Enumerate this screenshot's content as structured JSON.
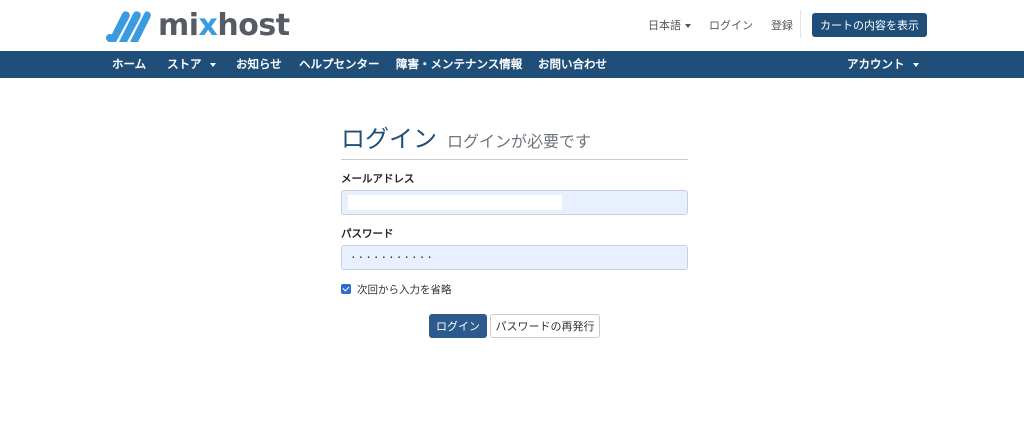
{
  "brand": {
    "name_part1": "mi",
    "name_x": "x",
    "name_part2": "host",
    "logo_icon": "stripes-logo-icon",
    "accent": "#3a9be0"
  },
  "header": {
    "language": "日本語",
    "login_link": "ログイン",
    "register_link": "登録",
    "cart_button": "カートの内容を表示"
  },
  "nav": {
    "items": [
      "ホーム",
      "ストア",
      "お知らせ",
      "ヘルプセンター",
      "障害・メンテナンス情報",
      "お問い合わせ"
    ],
    "account": "アカウント"
  },
  "login": {
    "title": "ログイン",
    "subtitle": "ログインが必要です",
    "email_label": "メールアドレス",
    "email_value": "",
    "password_label": "パスワード",
    "password_value": "···········",
    "remember_label": "次回から入力を省略",
    "remember_checked": true,
    "login_button": "ログイン",
    "reset_button": "パスワードの再発行"
  },
  "colors": {
    "navbar": "#1f4e79",
    "primary_button": "#2d5a8c",
    "input_bg": "#e8f0fe"
  }
}
